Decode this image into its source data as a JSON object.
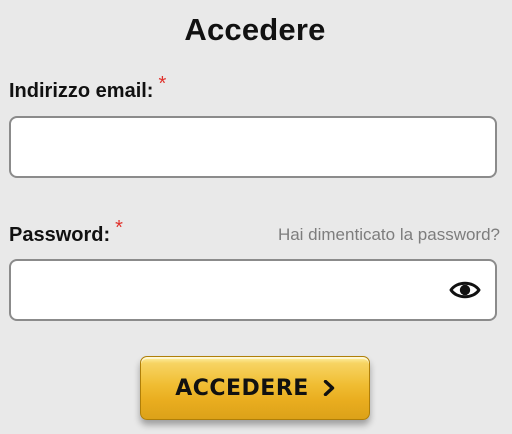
{
  "title": "Accedere",
  "email": {
    "label": "Indirizzo email:",
    "required_mark": "*",
    "value": "",
    "placeholder": ""
  },
  "password": {
    "label": "Password:",
    "required_mark": "*",
    "forgot_link": "Hai dimenticato la password?",
    "value": "",
    "placeholder": "",
    "toggle_icon": "eye-icon"
  },
  "submit": {
    "label": "ACCEDERE",
    "icon": "chevron-right-icon"
  },
  "colors": {
    "background": "#e9e9e9",
    "required": "#e0302a",
    "button_gold": "#f0bd32",
    "link_gray": "#7d7d7d"
  }
}
